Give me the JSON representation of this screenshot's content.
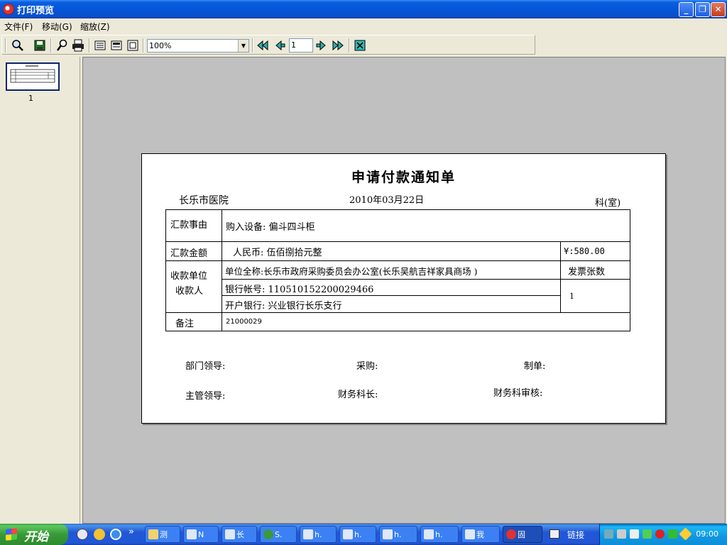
{
  "window": {
    "title": "打印预览"
  },
  "menu": [
    "文件(F)",
    "移动(G)",
    "缩放(Z)"
  ],
  "toolbar": {
    "zoom": "100%",
    "page": "1"
  },
  "thumbnail": {
    "label": "1"
  },
  "document": {
    "title": "申请付款通知单",
    "hospital": "长乐市医院",
    "date": "2010年03月22日",
    "dept": "科(室)",
    "rows": {
      "reason_label": "汇款事由",
      "reason_value": "购入设备: 偏斗四斗柜",
      "amount_label": "汇款金额",
      "amount_value": "人民币:  伍佰捌拾元整",
      "amount_num": "¥:580.00",
      "payee_label_1": "收款单位",
      "payee_label_2": "收款人",
      "payee_name": "单位全称:长乐市政府采购委员会办公室(长乐吴航吉祥家具商场       )",
      "invoice_label": "发票张数",
      "invoice_count": "1",
      "bank_account": "银行帐号: 110510152200029466",
      "bank_name": "开户银行: 兴业银行长乐支行",
      "note_label": "备注",
      "note_value": "21000029"
    },
    "signatures": {
      "dept_leader": "部门领导:",
      "purchase": "采购:",
      "maker": "制单:",
      "supervisor": "主管领导:",
      "finance_chief": "财务科长:",
      "finance_audit": "财务科审核:"
    }
  },
  "taskbar": {
    "start": "开始",
    "chevron": "»",
    "items": [
      "测",
      "N",
      "长",
      "S.",
      "h.",
      "h.",
      "h.",
      "h.",
      "我",
      "固"
    ],
    "links": "链接",
    "clock": "09:00"
  }
}
